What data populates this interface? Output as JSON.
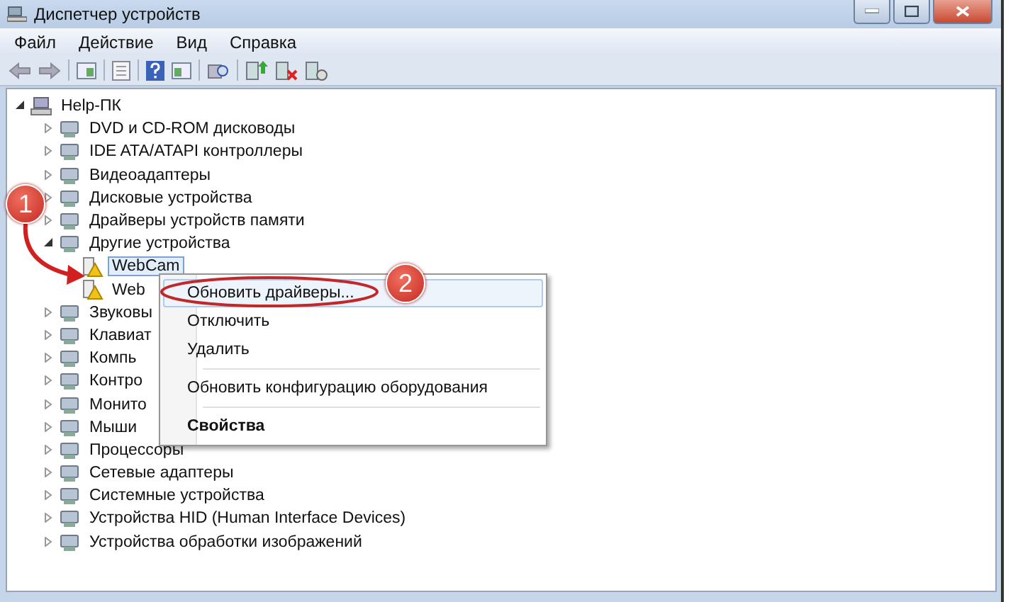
{
  "window": {
    "title": "Диспетчер устройств"
  },
  "menu": [
    "Файл",
    "Действие",
    "Вид",
    "Справка"
  ],
  "tree": {
    "label": "Help-ПК",
    "expanded": true,
    "children": [
      {
        "label": "DVD и CD-ROM дисководы",
        "expanded": false
      },
      {
        "label": "IDE ATA/ATAPI контроллеры",
        "expanded": false
      },
      {
        "label": "Видеоадаптеры",
        "expanded": false
      },
      {
        "label": "Дисковые устройства",
        "expanded": false
      },
      {
        "label": "Драйверы устройств памяти",
        "expanded": false
      },
      {
        "label": "Другие устройства",
        "expanded": true,
        "children": [
          {
            "label": "WebCam",
            "selected": true,
            "warning": true
          },
          {
            "label": "Web",
            "selected": false,
            "warning": true
          }
        ]
      },
      {
        "label": "Звуковы",
        "expanded": false
      },
      {
        "label": "Клавиат",
        "expanded": false
      },
      {
        "label": "Компь",
        "expanded": false
      },
      {
        "label": "Контро",
        "expanded": false
      },
      {
        "label": "Монито",
        "expanded": false
      },
      {
        "label": "Мыши",
        "expanded": false
      },
      {
        "label": "Процессоры",
        "expanded": false
      },
      {
        "label": "Сетевые адаптеры",
        "expanded": false
      },
      {
        "label": "Системные устройства",
        "expanded": false
      },
      {
        "label": "Устройства HID (Human Interface Devices)",
        "expanded": false
      },
      {
        "label": "Устройства обработки изображений",
        "expanded": false
      }
    ]
  },
  "context_menu": [
    {
      "kind": "item",
      "label": "Обновить драйверы...",
      "highlighted": true,
      "bold": false
    },
    {
      "kind": "item",
      "label": "Отключить",
      "highlighted": false,
      "bold": false
    },
    {
      "kind": "item",
      "label": "Удалить",
      "highlighted": false,
      "bold": false
    },
    {
      "kind": "separator"
    },
    {
      "kind": "item",
      "label": "Обновить конфигурацию оборудования",
      "highlighted": false,
      "bold": false
    },
    {
      "kind": "separator"
    },
    {
      "kind": "item",
      "label": "Свойства",
      "highlighted": false,
      "bold": true
    }
  ],
  "annotations": [
    "1",
    "2"
  ]
}
